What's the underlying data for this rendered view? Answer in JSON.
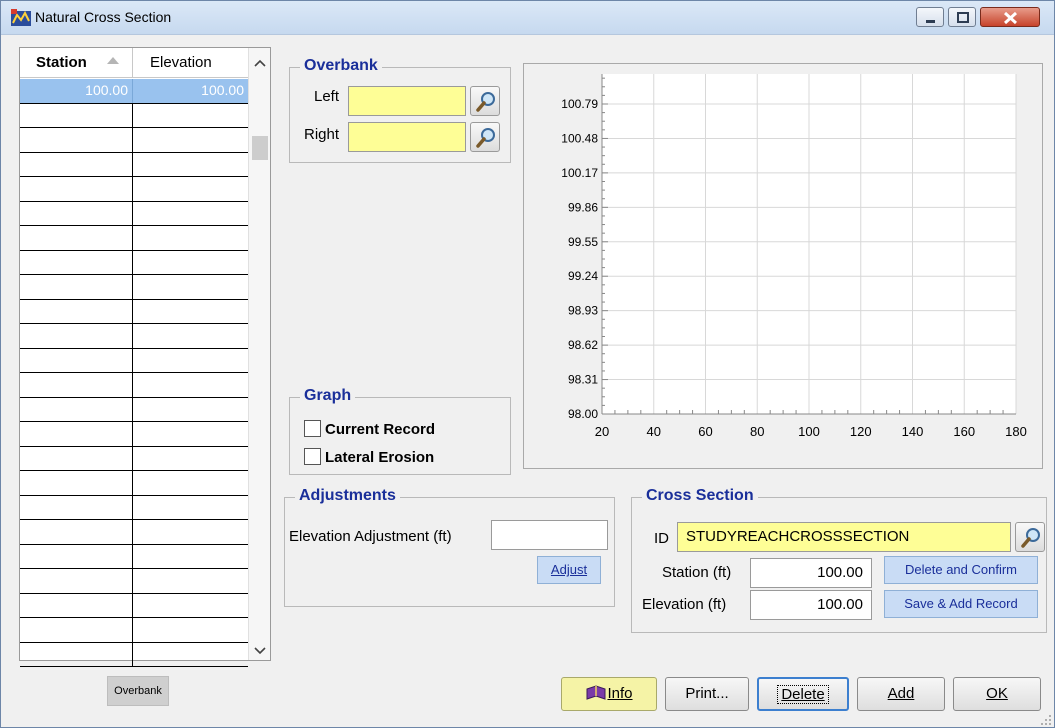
{
  "window": {
    "title": "Natural Cross Section"
  },
  "grid": {
    "headers": {
      "station": "Station",
      "elevation": "Elevation"
    },
    "selected_row": {
      "station": "100.00",
      "elevation": "100.00"
    },
    "empty_rows": 23
  },
  "overbank": {
    "title": "Overbank",
    "left_label": "Left",
    "right_label": "Right",
    "left_value": "",
    "right_value": ""
  },
  "graph": {
    "title": "Graph",
    "current_record": "Current Record",
    "lateral_erosion": "Lateral Erosion"
  },
  "adjustments": {
    "title": "Adjustments",
    "elevation_label": "Elevation Adjustment (ft)",
    "elevation_value": "",
    "adjust_button": "Adjust"
  },
  "cross_section": {
    "title": "Cross Section",
    "id_label": "ID",
    "id_value": "STUDYREACHCROSSSECTION",
    "station_label": "Station (ft)",
    "station_value": "100.00",
    "elevation_label": "Elevation (ft)",
    "elevation_value": "100.00",
    "delete_confirm_button": "Delete and Confirm",
    "save_add_button": "Save & Add Record"
  },
  "side_button": {
    "overbank": "Overbank"
  },
  "buttons": {
    "info": "Info",
    "print": "Print...",
    "delete": "Delete",
    "add": "Add",
    "ok": "OK"
  },
  "chart_data": {
    "type": "line",
    "title": "",
    "xlabel": "",
    "ylabel": "",
    "x_ticks": [
      "20",
      "40",
      "60",
      "80",
      "100",
      "120",
      "140",
      "160",
      "180"
    ],
    "y_ticks": [
      "98.00",
      "98.31",
      "98.62",
      "98.93",
      "99.24",
      "99.55",
      "99.86",
      "100.17",
      "100.48",
      "100.79"
    ],
    "xlim": [
      20,
      180
    ],
    "ylim": [
      98.0,
      100.79
    ],
    "grid": true,
    "series": []
  },
  "colors": {
    "title_bar": "#c6d9ef",
    "group_title": "#1a2f9a",
    "yellow_field": "#fefe96",
    "selection": "#99c2ee",
    "blue_button": "#c9dcf5"
  }
}
